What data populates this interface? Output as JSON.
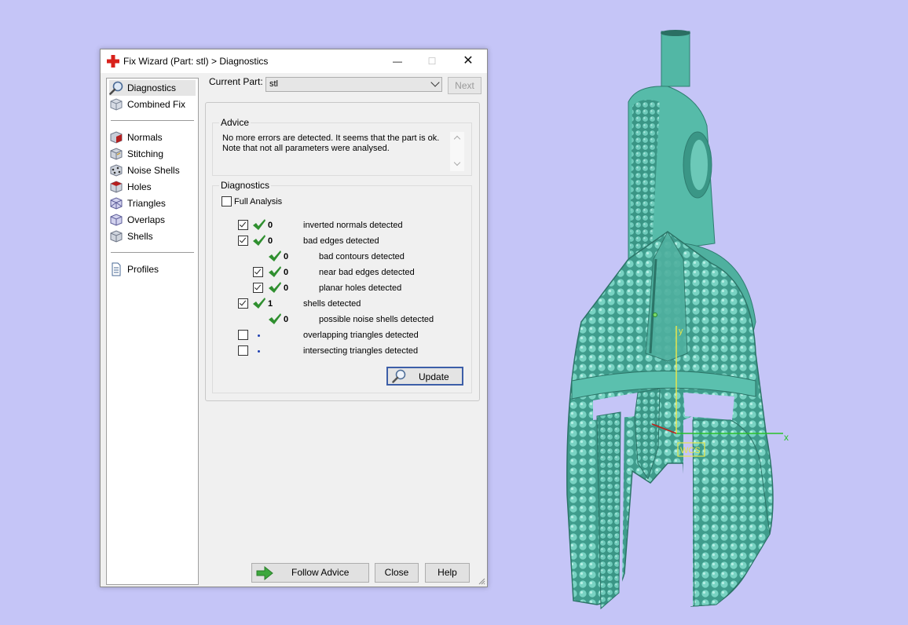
{
  "window": {
    "title": "Fix Wizard (Part: stl) > Diagnostics",
    "controls": {
      "minimize": "—",
      "maximize": "☐",
      "close": "✕"
    }
  },
  "nav": {
    "items": [
      {
        "label": "Diagnostics",
        "icon": "magnifier-icon",
        "selected": true
      },
      {
        "label": "Combined Fix",
        "icon": "cube-icon"
      },
      {
        "label": "Normals",
        "icon": "normals-cube-icon"
      },
      {
        "label": "Stitching",
        "icon": "stitching-cube-icon"
      },
      {
        "label": "Noise Shells",
        "icon": "noise-shells-icon"
      },
      {
        "label": "Holes",
        "icon": "holes-cube-icon"
      },
      {
        "label": "Triangles",
        "icon": "triangles-cube-icon"
      },
      {
        "label": "Overlaps",
        "icon": "overlaps-cube-icon"
      },
      {
        "label": "Shells",
        "icon": "shells-cube-icon"
      },
      {
        "label": "Profiles",
        "icon": "document-icon"
      }
    ]
  },
  "current_part": {
    "label": "Current Part:",
    "value": "stl"
  },
  "next_label": "Next",
  "advice": {
    "title": "Advice",
    "line1": "No more errors are detected. It seems that the part is ok.",
    "line2": "Note that not all parameters were analysed."
  },
  "diagnostics": {
    "title": "Diagnostics",
    "full_analysis": {
      "label": "Full Analysis",
      "checked": false
    },
    "rows": [
      {
        "checkbox": true,
        "checked": true,
        "status": "ok",
        "count": "0",
        "label": "inverted normals detected"
      },
      {
        "checkbox": true,
        "checked": true,
        "status": "ok",
        "count": "0",
        "label": "bad edges detected"
      },
      {
        "checkbox": false,
        "status": "ok",
        "count": "0",
        "label": "bad contours detected"
      },
      {
        "checkbox": true,
        "checked": true,
        "status": "ok",
        "count": "0",
        "label": "near bad edges detected"
      },
      {
        "checkbox": true,
        "checked": true,
        "status": "ok",
        "count": "0",
        "label": "planar holes detected"
      },
      {
        "checkbox": true,
        "checked": true,
        "status": "ok",
        "count": "1",
        "label": "shells detected"
      },
      {
        "checkbox": false,
        "status": "ok",
        "count": "0",
        "label": "possible noise shells detected"
      },
      {
        "checkbox": true,
        "checked": false,
        "status": "not-analysed",
        "count": "",
        "label": "overlapping triangles detected"
      },
      {
        "checkbox": true,
        "checked": false,
        "status": "not-analysed",
        "count": "",
        "label": "intersecting triangles detected"
      }
    ],
    "update_label": "Update"
  },
  "buttons": {
    "follow_advice": "Follow Advice",
    "close": "Close",
    "help": "Help"
  },
  "viewport": {
    "axis_x_label": "x",
    "axis_y_label": "y",
    "wcs_label": "WCS",
    "background_color": "#c5c5f7",
    "model_color": "#5fbfae"
  }
}
